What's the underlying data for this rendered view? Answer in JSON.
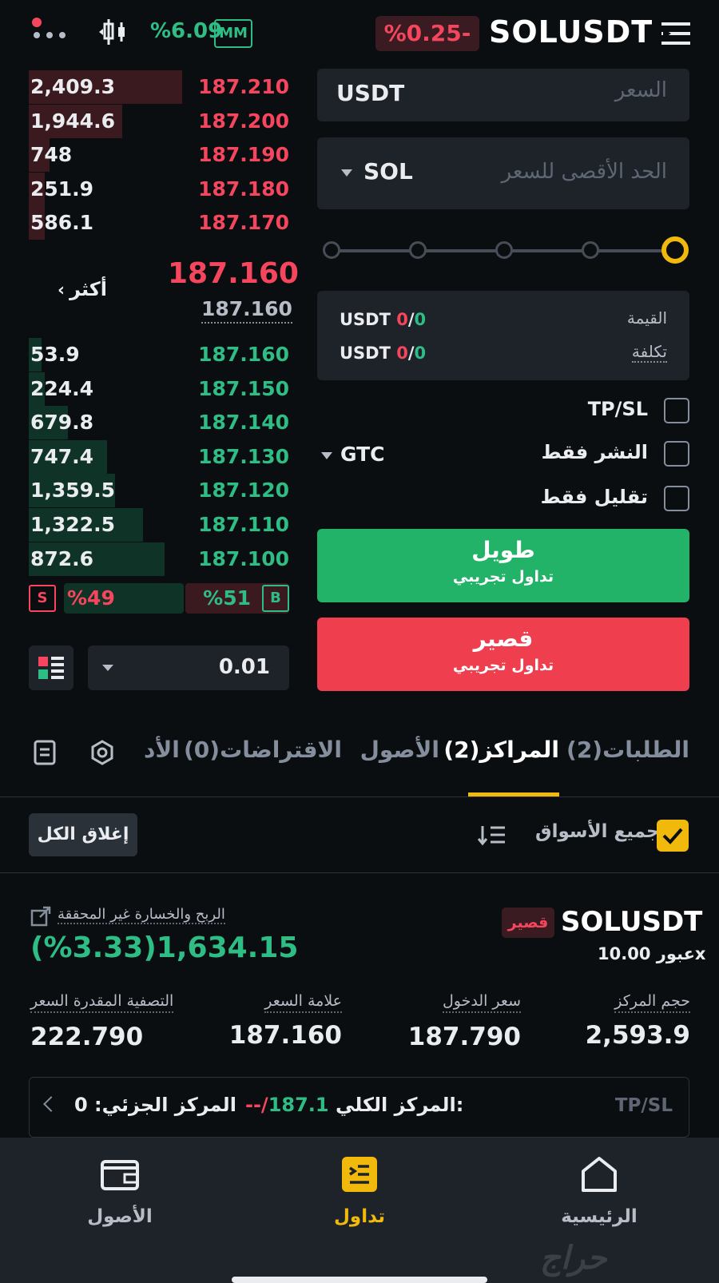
{
  "header": {
    "change_pct": "%6.09",
    "mm_badge": "MM",
    "price_change": "%0.25-",
    "symbol": "SOLUSDT"
  },
  "orderbook": {
    "asks": [
      {
        "qty": "2,409.3",
        "price": "187.210",
        "depth": 0.59
      },
      {
        "qty": "1,944.6",
        "price": "187.200",
        "depth": 0.36
      },
      {
        "qty": "748",
        "price": "187.190",
        "depth": 0.08
      },
      {
        "qty": "251.9",
        "price": "187.180",
        "depth": 0.06
      },
      {
        "qty": "586.1",
        "price": "187.170",
        "depth": 0.06
      }
    ],
    "mid_price": "187.160",
    "mark_price": "187.160",
    "more_label": "أكثر",
    "bids": [
      {
        "qty": "53.9",
        "price": "187.160",
        "depth": 0.05
      },
      {
        "qty": "224.4",
        "price": "187.150",
        "depth": 0.06
      },
      {
        "qty": "679.8",
        "price": "187.140",
        "depth": 0.15
      },
      {
        "qty": "747.4",
        "price": "187.130",
        "depth": 0.3
      },
      {
        "qty": "1,359.5",
        "price": "187.120",
        "depth": 0.33
      },
      {
        "qty": "1,322.5",
        "price": "187.110",
        "depth": 0.44
      },
      {
        "qty": "872.6",
        "price": "187.100",
        "depth": 0.52
      }
    ],
    "sell_badge": "S",
    "sell_pct": "%49",
    "buy_pct": "%51",
    "buy_badge": "B",
    "tick_size": "0.01"
  },
  "form": {
    "price_unit": "USDT",
    "price_placeholder": "السعر",
    "max_unit": "SOL",
    "max_placeholder": "الحد الأقصى للسعر",
    "value_label": "القيمة",
    "cost_label": "تكلفة",
    "value_unit": "USDT",
    "value_a": "0",
    "value_b": "0",
    "cost_a": "0",
    "cost_b": "0",
    "tpsl_label": "TP/SL",
    "post_only_label": "النشر فقط",
    "reduce_only_label": "تقليل فقط",
    "tif": "GTC",
    "long_title": "طويل",
    "long_sub": "تداول تجريبي",
    "short_title": "قصير",
    "short_sub": "تداول تجريبي"
  },
  "tabs": {
    "orders": "الطلبات(2)",
    "positions": "المراكز(2)",
    "assets": "الأصول",
    "borrowings": "الاقتراضات(0)",
    "more": "الأد"
  },
  "filter": {
    "all_markets": "جميع الأسواق",
    "close_all": "إغلاق الكل"
  },
  "position": {
    "symbol": "SOLUSDT",
    "side": "قصير",
    "leverage": "عبور 10.00x",
    "upnl_label": "الربح والخسارة غير المحققة",
    "upnl_value": "(%3.33)1,634.15",
    "size_label": "حجم المركز",
    "size_value": "2,593.9",
    "entry_label": "سعر الدخول",
    "entry_value": "187.790",
    "mark_label": "علامة السعر",
    "mark_value": "187.160",
    "liq_label": "التصفية المقدرة السعر",
    "liq_value": "222.790",
    "tpsl_label": "TP/SL",
    "full_label": "المركز الكلي:",
    "full_tp": "187.1",
    "full_sl": "--/",
    "partial_label": "المركز الجزئي: 0"
  },
  "nav": {
    "home": "الرئيسية",
    "trade": "تداول",
    "assets": "الأصول"
  },
  "watermark": "حراج",
  "colors": {
    "green": "#2ebd85",
    "red": "#f6465d",
    "accent": "#f0b90b"
  }
}
